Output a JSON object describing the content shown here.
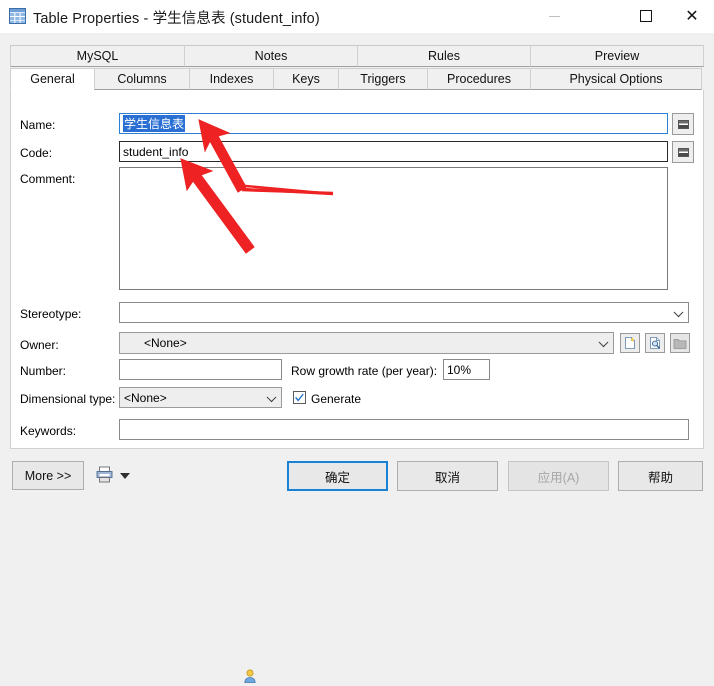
{
  "window": {
    "title": "Table Properties - 学生信息表 (student_info)",
    "icon": "table-icon",
    "controls": {
      "minimize": "—",
      "maximize": "▢",
      "close": "✕"
    }
  },
  "tabs": {
    "row1": [
      {
        "label": "MySQL",
        "active": false
      },
      {
        "label": "Notes",
        "active": false
      },
      {
        "label": "Rules",
        "active": false
      },
      {
        "label": "Preview",
        "active": false
      }
    ],
    "row2": [
      {
        "label": "General",
        "active": true
      },
      {
        "label": "Columns",
        "active": false
      },
      {
        "label": "Indexes",
        "active": false
      },
      {
        "label": "Keys",
        "active": false
      },
      {
        "label": "Triggers",
        "active": false
      },
      {
        "label": "Procedures",
        "active": false
      },
      {
        "label": "Physical Options",
        "active": false
      }
    ]
  },
  "form": {
    "name": {
      "label": "Name:",
      "value": "学生信息表",
      "selected": true
    },
    "code": {
      "label": "Code:",
      "value": "student_info"
    },
    "comment": {
      "label": "Comment:",
      "value": ""
    },
    "stereotype": {
      "label": "Stereotype:",
      "value": ""
    },
    "owner": {
      "label": "Owner:",
      "value": "<None>",
      "icon": "person-icon"
    },
    "number": {
      "label": "Number:",
      "value": ""
    },
    "row_growth": {
      "label": "Row growth rate (per year):",
      "value": "10%"
    },
    "dimensional_type": {
      "label": "Dimensional type:",
      "value": "<None>"
    },
    "generate": {
      "label": "Generate",
      "checked": true
    },
    "keywords": {
      "label": "Keywords:",
      "value": ""
    },
    "sync_button_label": "=",
    "owner_buttons": [
      {
        "name": "new-owner-button",
        "icon": "new-document-icon",
        "disabled": false
      },
      {
        "name": "browse-owner-button",
        "icon": "magnify-document-icon",
        "disabled": false
      },
      {
        "name": "open-owner-button",
        "icon": "folder-icon",
        "disabled": true
      }
    ]
  },
  "footer": {
    "more": "More >>",
    "print_icon": "printer-icon",
    "ok": "确定",
    "cancel": "取消",
    "apply": "应用(A)",
    "help": "帮助",
    "apply_disabled": true
  },
  "annotations": {
    "arrow_color": "#ee2222",
    "arrows": [
      {
        "name": "arrow-to-name-field",
        "points_to": "name-input"
      },
      {
        "name": "arrow-to-code-field",
        "points_to": "code-input"
      }
    ]
  },
  "colors": {
    "accent": "#1782d6",
    "selection": "#2a6fd4",
    "dialog_bg": "#f0f0f0",
    "panel_bg": "#ffffff"
  }
}
